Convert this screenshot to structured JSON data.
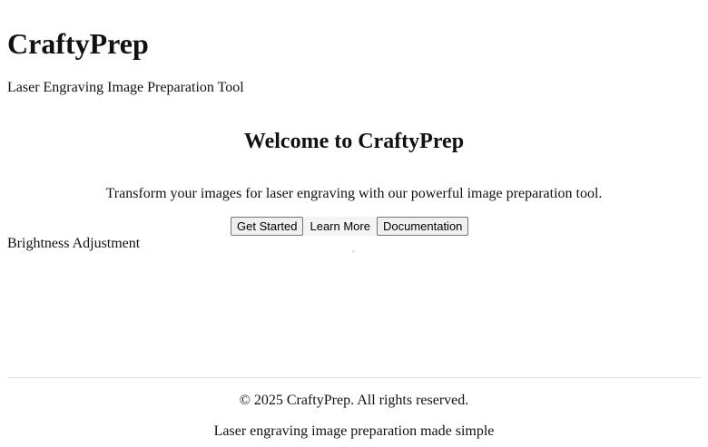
{
  "header": {
    "title": "CraftyPrep",
    "tagline": "Laser Engraving Image Preparation Tool"
  },
  "hero": {
    "title": "Welcome to CraftyPrep",
    "description": "Transform your images for laser engraving with our powerful image preparation tool.",
    "buttons": {
      "get_started": "Get Started",
      "learn_more": "Learn More",
      "documentation": "Documentation"
    }
  },
  "tools": {
    "brightness_label": "Brightness Adjustment"
  },
  "footer": {
    "copyright": "© 2025 CraftyPrep. All rights reserved.",
    "note": "Laser engraving image preparation made simple"
  }
}
